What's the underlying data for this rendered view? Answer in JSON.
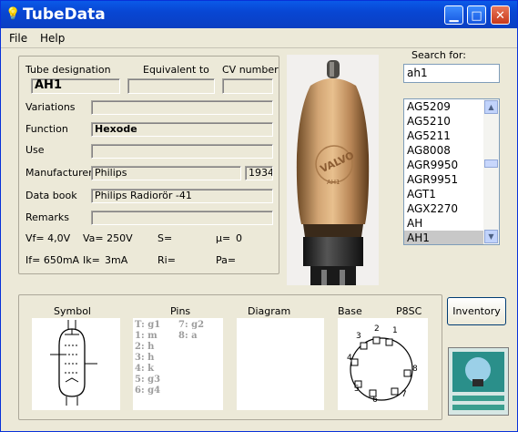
{
  "window": {
    "title": "TubeData"
  },
  "menu": {
    "file": "File",
    "help": "Help"
  },
  "details": {
    "tube_designation_label": "Tube designation",
    "equivalent_label": "Equivalent to",
    "cv_label": "CV number",
    "tube_designation": "AH1",
    "equivalent": "",
    "cv_number": "",
    "variations_label": "Variations",
    "variations": "",
    "function_label": "Function",
    "function": "Hexode",
    "use_label": "Use",
    "use": "",
    "manufacturer_label": "Manufacturer",
    "manufacturer": "Philips",
    "year": "1934",
    "databook_label": "Data book",
    "databook": "Philips Radiorör -41",
    "remarks_label": "Remarks",
    "remarks": "",
    "params": {
      "vf": "Vf= 4,0V",
      "va": "Va= 250V",
      "s": "S=",
      "mu": "µ=",
      "mu_val": "0",
      "if": "If= 650mA",
      "ik": "Ik=",
      "ik_val": "3mA",
      "ri": "Ri=",
      "pa": "Pa="
    }
  },
  "tube_photo": {
    "brand": "VALVO",
    "type": "AH1"
  },
  "search": {
    "label": "Search for:",
    "value": "ah1"
  },
  "tube_list": [
    "AG5209",
    "AG5210",
    "AG5211",
    "AG8008",
    "AGR9950",
    "AGR9951",
    "AGT1",
    "AGX2270",
    "AH",
    "AH1"
  ],
  "tube_list_selected": 9,
  "lower": {
    "symbol_label": "Symbol",
    "pins_label": "Pins",
    "diagram_label": "Diagram",
    "base_label": "Base",
    "base_type": "P8SC",
    "pins_col1": [
      "T: g1",
      "1: m",
      "2: h",
      "3: h",
      "4: k",
      "5: g3",
      "6: g4"
    ],
    "pins_col2": [
      "7: g2",
      "8: a"
    ],
    "base_pins": [
      "1",
      "2",
      "3",
      "4",
      "5",
      "6",
      "7",
      "8"
    ]
  },
  "buttons": {
    "inventory": "Inventory"
  },
  "colors": {
    "titlebar": "#0846d3",
    "window_bg": "#ece9d8",
    "selection": "#c8c8c8"
  }
}
